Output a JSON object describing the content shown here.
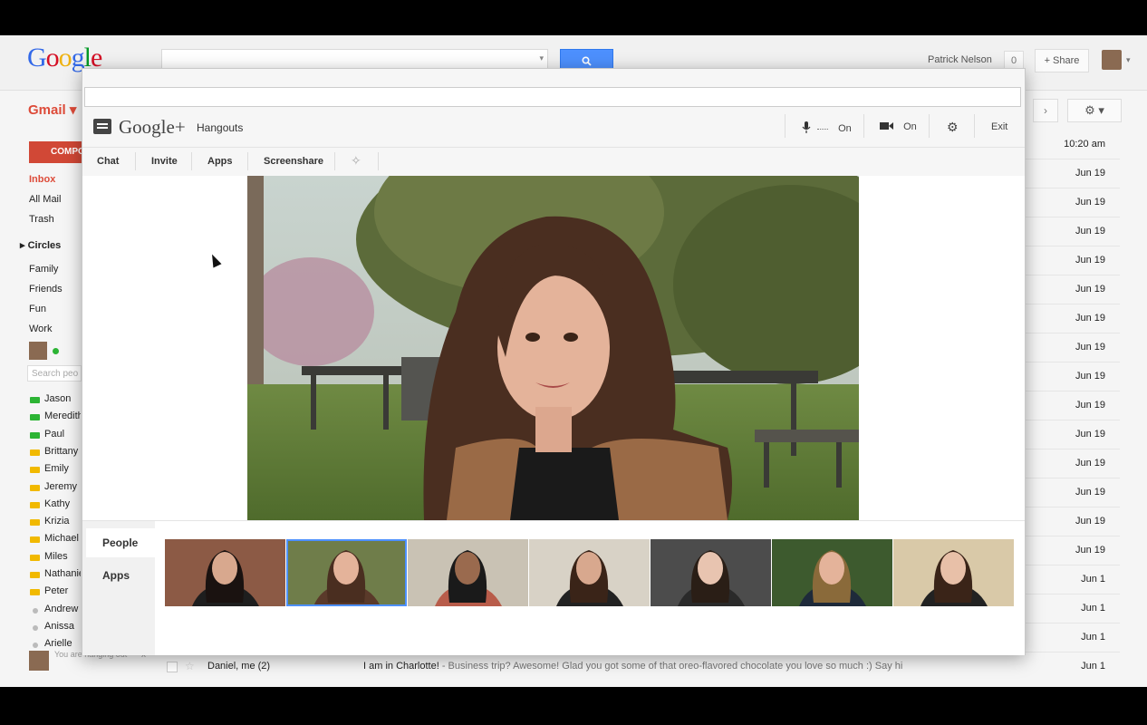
{
  "gmail": {
    "logo_letters": [
      "G",
      "o",
      "o",
      "g",
      "l",
      "e"
    ],
    "logo_colors": [
      "#3369e8",
      "#d50f25",
      "#eeb211",
      "#3369e8",
      "#009925",
      "#d50f25"
    ],
    "search_caret": "▾",
    "search_icon": "search-icon",
    "user_name": "Patrick Nelson",
    "notification_count": "0",
    "share_label": "+ Share",
    "avatar_caret": "▾",
    "app_label": "Gmail ▾",
    "compose_label": "COMPO",
    "nav": [
      "Inbox",
      "All Mail",
      "Trash"
    ],
    "circles_label": "▸ Circles",
    "circles": [
      "Family",
      "Friends",
      "Fun",
      "Work"
    ],
    "search_people_placeholder": "Search peo",
    "contacts": [
      {
        "name": "Jason",
        "status": "video"
      },
      {
        "name": "Meredith",
        "status": "video"
      },
      {
        "name": "Paul",
        "status": "video"
      },
      {
        "name": "Brittany",
        "status": "video-idle"
      },
      {
        "name": "Emily",
        "status": "video-idle"
      },
      {
        "name": "Jeremy",
        "status": "video-idle"
      },
      {
        "name": "Kathy",
        "status": "video-idle"
      },
      {
        "name": "Krizia",
        "status": "video-idle"
      },
      {
        "name": "Michael",
        "status": "video-idle"
      },
      {
        "name": "Miles",
        "status": "video-idle"
      },
      {
        "name": "Nathanie",
        "status": "video-idle"
      },
      {
        "name": "Peter",
        "status": "video-idle"
      },
      {
        "name": "Andrew",
        "status": "offline"
      },
      {
        "name": "Anissa",
        "status": "offline"
      },
      {
        "name": "Arielle",
        "status": "offline"
      }
    ],
    "hangout_status": "You are hanging out",
    "hangout_status_close": "x",
    "older_arrow": "›",
    "settings_icon": "⚙ ▾",
    "dates": [
      "10:20 am",
      "Jun 19",
      "Jun 19",
      "Jun 19",
      "Jun 19",
      "Jun 19",
      "Jun 19",
      "Jun 19",
      "Jun 19",
      "Jun 19",
      "Jun 19",
      "Jun 19",
      "Jun 19",
      "Jun 19",
      "Jun 19",
      "Jun 1",
      "Jun 1",
      "Jun 1"
    ],
    "bottom_row": {
      "sender": "Daniel, me (2)",
      "subject": "I am in Charlotte!",
      "snippet": " - Business trip? Awesome! Glad you got some of that oreo-flavored chocolate you love so much :) Say hi",
      "date": "Jun 1"
    }
  },
  "hangout": {
    "brand": "Google+",
    "product": "Hangouts",
    "mic_state": "On",
    "camera_state": "On",
    "exit_label": "Exit",
    "tabs": [
      "Chat",
      "Invite",
      "Apps",
      "Screenshare"
    ],
    "side_tabs": [
      "People",
      "Apps"
    ],
    "active_side_tab": "People",
    "selected_participant_index": 1,
    "participant_count": 7
  }
}
